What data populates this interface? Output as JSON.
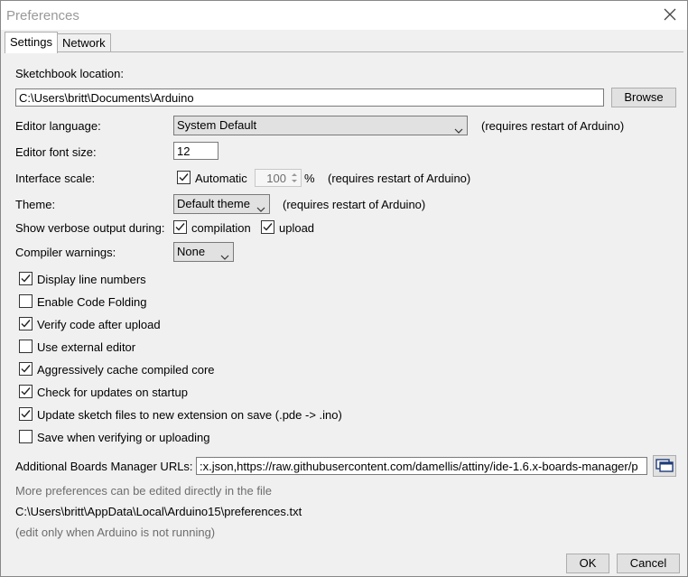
{
  "window": {
    "title": "Preferences"
  },
  "tabs": [
    {
      "label": "Settings"
    },
    {
      "label": "Network"
    }
  ],
  "settings": {
    "sketchbook_label": "Sketchbook location:",
    "sketchbook_path": "C:\\Users\\britt\\Documents\\Arduino",
    "browse_label": "Browse",
    "editor_language_label": "Editor language:",
    "editor_language_value": "System Default",
    "restart_note": "(requires restart of Arduino)",
    "font_size_label": "Editor font size:",
    "font_size_value": "12",
    "interface_scale_label": "Interface scale:",
    "automatic_label": "Automatic",
    "automatic_checked": true,
    "scale_value": "100",
    "percent": "%",
    "theme_label": "Theme:",
    "theme_value": "Default theme",
    "verbose_label": "Show verbose output during:",
    "compilation_label": "compilation",
    "compilation_checked": true,
    "upload_label": "upload",
    "upload_checked": true,
    "compiler_warnings_label": "Compiler warnings:",
    "compiler_warnings_value": "None",
    "options": [
      {
        "label": "Display line numbers",
        "checked": true
      },
      {
        "label": "Enable Code Folding",
        "checked": false
      },
      {
        "label": "Verify code after upload",
        "checked": true
      },
      {
        "label": "Use external editor",
        "checked": false
      },
      {
        "label": "Aggressively cache compiled core",
        "checked": true
      },
      {
        "label": "Check for updates on startup",
        "checked": true
      },
      {
        "label": "Update sketch files to new extension on save (.pde -> .ino)",
        "checked": true
      },
      {
        "label": "Save when verifying or uploading",
        "checked": false
      }
    ],
    "boards_urls_label": "Additional Boards Manager URLs:",
    "boards_urls_value": ":x.json,https://raw.githubusercontent.com/damellis/attiny/ide-1.6.x-boards-manager/p",
    "more_prefs_note": "More preferences can be edited directly in the file",
    "prefs_path": "C:\\Users\\britt\\AppData\\Local\\Arduino15\\preferences.txt",
    "edit_note": "(edit only when Arduino is not running)"
  },
  "footer": {
    "ok_label": "OK",
    "cancel_label": "Cancel"
  },
  "colors": {
    "accent": "#0078d7",
    "gray_text": "#6d6d6d"
  }
}
